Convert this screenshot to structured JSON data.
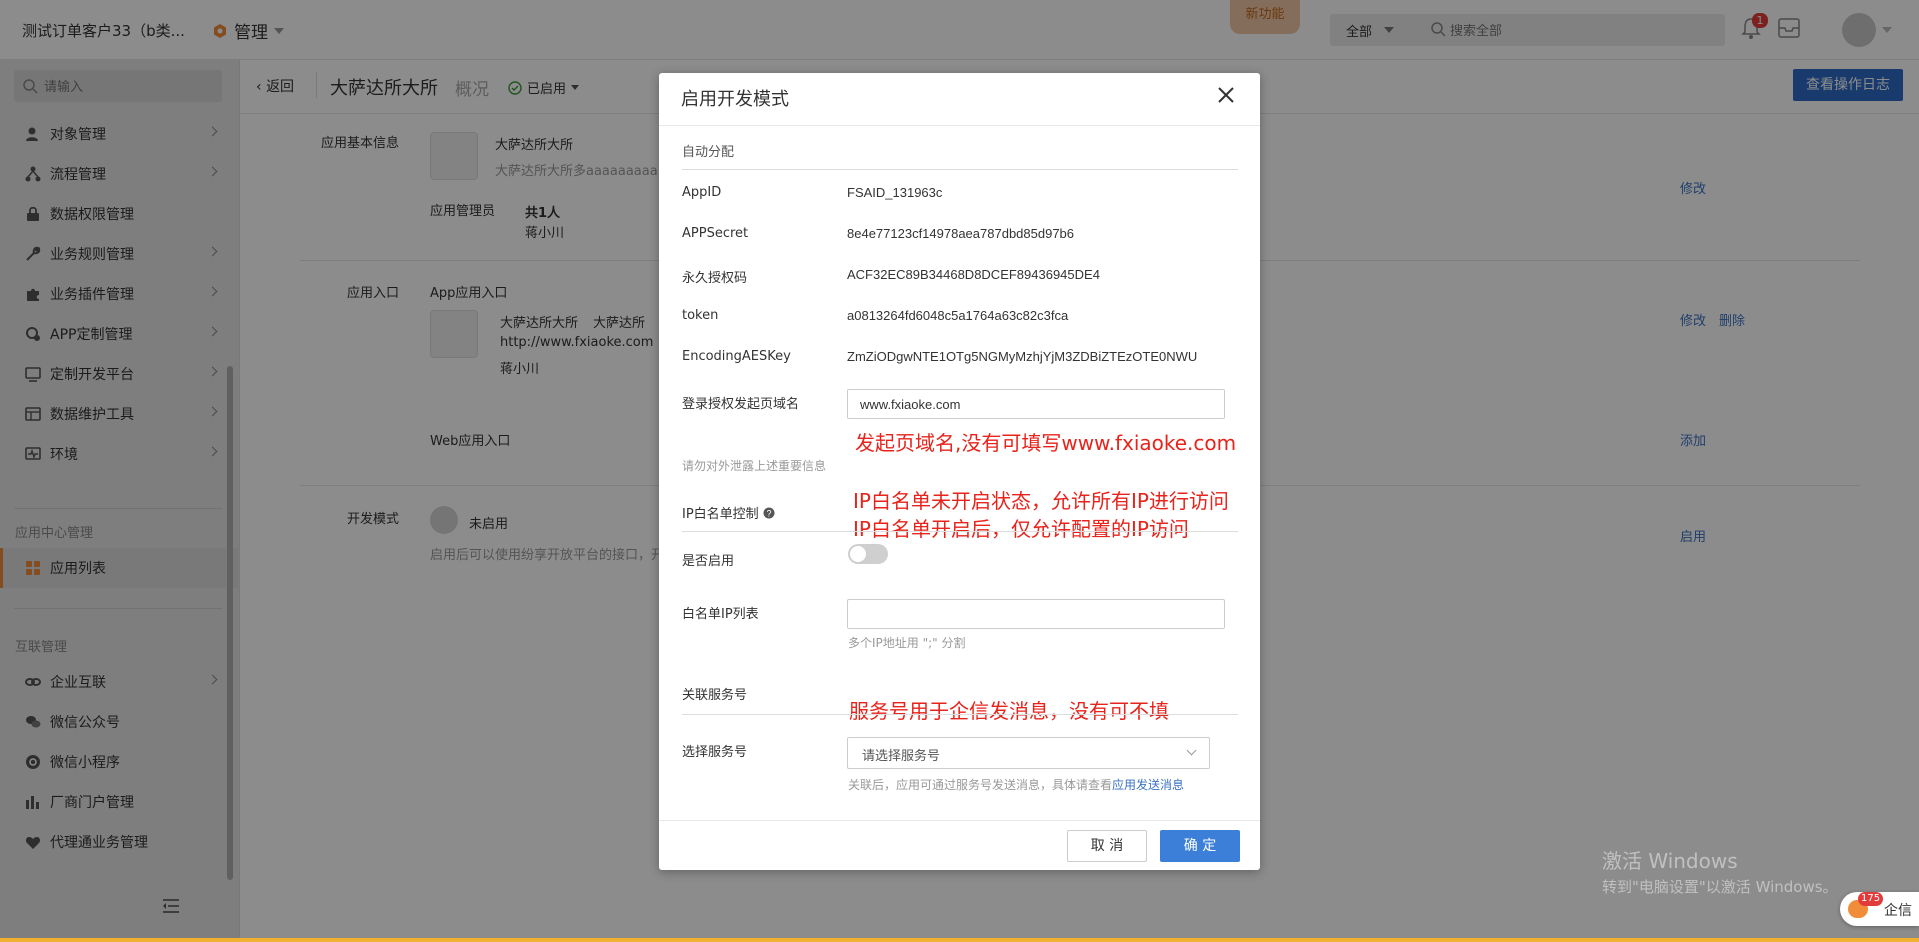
{
  "header": {
    "company": "测试订单客户33（b类...",
    "module": "管理",
    "new_feature": "新功能",
    "search_scope": "全部",
    "search_placeholder": "搜索全部",
    "notification_count": "1"
  },
  "sidebar": {
    "search_placeholder": "请输入",
    "items": [
      {
        "label": "对象管理",
        "icon": "user-gear-icon"
      },
      {
        "label": "流程管理",
        "icon": "flow-icon"
      },
      {
        "label": "数据权限管理",
        "icon": "lock-icon"
      },
      {
        "label": "业务规则管理",
        "icon": "wrench-icon"
      },
      {
        "label": "业务插件管理",
        "icon": "puzzle-icon"
      },
      {
        "label": "APP定制管理",
        "icon": "app-gear-icon"
      },
      {
        "label": "定制开发平台",
        "icon": "dev-platform-icon"
      },
      {
        "label": "数据维护工具",
        "icon": "data-tool-icon"
      },
      {
        "label": "环境",
        "icon": "pulse-icon"
      }
    ],
    "section_app_center": "应用中心管理",
    "app_list": "应用列表",
    "section_interconnect": "互联管理",
    "interconnect_items": [
      {
        "label": "企业互联",
        "icon": "link-icon"
      },
      {
        "label": "微信公众号",
        "icon": "wechat-icon"
      },
      {
        "label": "微信小程序",
        "icon": "mini-program-icon"
      },
      {
        "label": "厂商门户管理",
        "icon": "portal-icon"
      },
      {
        "label": "代理通业务管理",
        "icon": "agent-icon"
      }
    ]
  },
  "main": {
    "back": "返回",
    "app_name": "大萨达所大所",
    "overview": "概况",
    "status": "已启用",
    "log_button": "查看操作日志",
    "basic_info_label": "应用基本信息",
    "basic_name": "大萨达所大所",
    "basic_desc": "大萨达所大所多aaaaaaaaa",
    "admin_label": "应用管理员",
    "admin_count": "共1人",
    "admin_name": "蒋小川",
    "edit": "修改",
    "entry_label": "应用入口",
    "app_entry": "App应用入口",
    "entry_name": "大萨达所大所",
    "entry_name2": "大萨达所",
    "entry_url": "http://www.fxiaoke.com",
    "entry_owner": "蒋小川",
    "delete": "删除",
    "web_entry": "Web应用入口",
    "add": "添加",
    "dev_mode_label": "开发模式",
    "dev_mode_status": "未启用",
    "dev_mode_desc": "启用后可以使用纷享开放平台的接口，开",
    "enable": "启用"
  },
  "modal": {
    "title": "启用开发模式",
    "section_auto": "自动分配",
    "fields": [
      {
        "label": "AppID",
        "value": "FSAID_131963c"
      },
      {
        "label": "APPSecret",
        "value": "8e4e77123cf14978aea787dbd85d97b6"
      },
      {
        "label": "永久授权码",
        "value": "ACF32EC89B34468D8DCEF89436945DE4"
      },
      {
        "label": "token",
        "value": "a0813264fd6048c5a1764a63c82c3fca"
      },
      {
        "label": "EncodingAESKey",
        "value": "ZmZiODgwNTE1OTg5NGMyMzhjYjM3ZDBiZTEzOTE0NWU"
      }
    ],
    "domain_label": "登录授权发起页域名",
    "domain_value": "www.fxiaoke.com",
    "warning": "请勿对外泄露上述重要信息",
    "ip_section": "IP白名单控制",
    "enable_label": "是否启用",
    "whitelist_label": "白名单IP列表",
    "whitelist_hint": "多个IP地址用 \";\" 分割",
    "service_section": "关联服务号",
    "select_label": "选择服务号",
    "select_placeholder": "请选择服务号",
    "service_hint": "关联后，应用可通过服务号发送消息，具体请查看",
    "service_hint_link": "应用发送消息",
    "cancel": "取 消",
    "ok": "确 定"
  },
  "annotations": {
    "domain": "发起页域名,没有可填写www.fxiaoke.com",
    "ip_line1": "IP白名单未开启状态，允许所有IP进行访问",
    "ip_line2": "IP白名单开启后，仅允许配置的IP访问",
    "service": "服务号用于企信发消息，没有可不填"
  },
  "watermark": {
    "line1": "激活 Windows",
    "line2": "转到\"电脑设置\"以激活 Windows。"
  },
  "qixin": {
    "label": "企信",
    "badge": "175"
  }
}
